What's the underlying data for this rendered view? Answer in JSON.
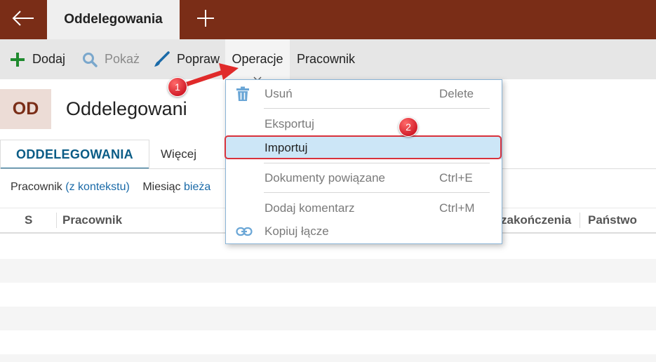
{
  "topbar": {
    "active_tab": "Oddelegowania"
  },
  "toolbar": {
    "add": "Dodaj",
    "show": "Pokaż",
    "edit": "Popraw",
    "operations": "Operacje",
    "employee": "Pracownik"
  },
  "header": {
    "badge": "OD",
    "title": "Oddelegowani"
  },
  "tabs": {
    "selected": "ODDELEGOWANIA",
    "more": "Więcej"
  },
  "filters": {
    "employee_label": "Pracownik",
    "employee_value": "(z kontekstu)",
    "month_label": "Miesiąc",
    "month_value": "bieża"
  },
  "grid": {
    "columns": [
      "S",
      "Pracownik",
      "zakończenia",
      "Państwo"
    ]
  },
  "menu": {
    "items": [
      {
        "label": "Usuń",
        "shortcut": "Delete",
        "icon": "trash-icon"
      },
      {
        "label": "Eksportuj",
        "shortcut": ""
      },
      {
        "label": "Importuj",
        "shortcut": ""
      },
      {
        "label": "Dokumenty powiązane",
        "shortcut": "Ctrl+E"
      },
      {
        "label": "Dodaj komentarz",
        "shortcut": "Ctrl+M"
      },
      {
        "label": "Kopiuj łącze",
        "shortcut": "",
        "icon": "link-icon"
      }
    ]
  },
  "callouts": {
    "one": "1",
    "two": "2"
  },
  "colors": {
    "brand": "#7a2d17",
    "accent_blue": "#0a5c86",
    "highlight": "#cce6f7",
    "callout_red": "#d21e2a"
  }
}
